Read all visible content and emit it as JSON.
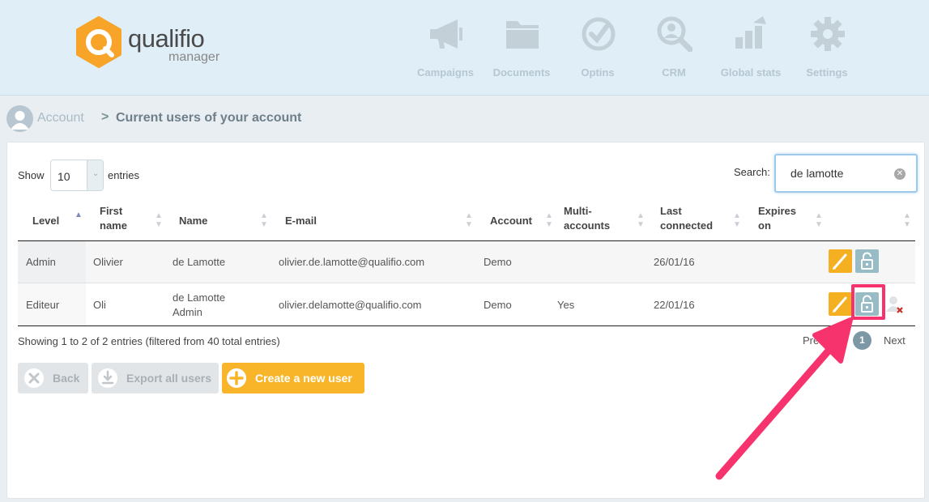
{
  "brand": {
    "name": "qualifio",
    "subtitle": "manager",
    "color": "#f8a428"
  },
  "nav": [
    {
      "label": "Campaigns",
      "icon": "megaphone-icon"
    },
    {
      "label": "Documents",
      "icon": "folder-icon"
    },
    {
      "label": "Optins",
      "icon": "check-circle-icon"
    },
    {
      "label": "CRM",
      "icon": "search-user-icon"
    },
    {
      "label": "Global stats",
      "icon": "bar-chart-icon"
    },
    {
      "label": "Settings",
      "icon": "gear-icon"
    }
  ],
  "breadcrumb": {
    "parent": "Account",
    "separator": ">",
    "current": "Current users of your account"
  },
  "table_controls": {
    "show_label": "Show",
    "page_size": "10",
    "entries_label": "entries",
    "search_label": "Search:",
    "search_value": "de lamotte"
  },
  "columns": [
    {
      "line1": "Level",
      "line2": ""
    },
    {
      "line1": "First",
      "line2": "name"
    },
    {
      "line1": "Name",
      "line2": ""
    },
    {
      "line1": "E-mail",
      "line2": ""
    },
    {
      "line1": "Account",
      "line2": ""
    },
    {
      "line1": "Multi-",
      "line2": "accounts"
    },
    {
      "line1": "Last",
      "line2": "connected"
    },
    {
      "line1": "Expires",
      "line2": "on"
    }
  ],
  "rows": [
    {
      "level": "Admin",
      "first_name": "Olivier",
      "name": "de Lamotte",
      "name2": "",
      "email": "olivier.de.lamotte@qualifio.com",
      "account": "Demo",
      "multi": "",
      "last": "26/01/16",
      "expires": ""
    },
    {
      "level": "Editeur",
      "first_name": "Oli",
      "name": "de Lamotte",
      "name2": "Admin",
      "email": "olivier.delamotte@qualifio.com",
      "account": "Demo",
      "multi": "Yes",
      "last": "22/01/16",
      "expires": ""
    }
  ],
  "footer": {
    "info": "Showing 1 to 2 of 2 entries (filtered from 40 total entries)",
    "prev": "Previous",
    "page": "1",
    "next": "Next"
  },
  "actions": {
    "back": "Back",
    "export": "Export all users",
    "create": "Create a new user"
  },
  "colors": {
    "accent": "#f9b52a",
    "lock": "#98bcc6",
    "highlight": "#f7336e"
  }
}
